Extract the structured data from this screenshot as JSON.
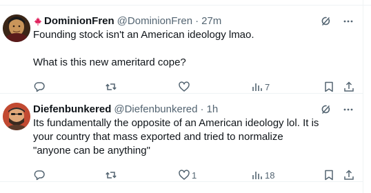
{
  "posts": [
    {
      "display_name": "DominionFren",
      "handle": "@DominionFren",
      "separator": "·",
      "time": "27m",
      "flag_icon": "canada-maple-leaf-icon",
      "text": "Founding stock isn't an American ideology lmao.\n\nWhat is this new ameritard cope?",
      "replies": "",
      "reposts": "",
      "likes": "",
      "views": "7"
    },
    {
      "display_name": "Diefenbunkered",
      "handle": "@Diefenbunkered",
      "separator": "·",
      "time": "1h",
      "text": "Its fundamentally the opposite of an American ideology lol. It is your country that mass exported and tried to normalize \"anyone can be anything\"",
      "replies": "",
      "reposts": "",
      "likes": "1",
      "views": "18"
    }
  ],
  "colors": {
    "text_primary": "#0f1419",
    "text_secondary": "#536471",
    "divider": "#eff3f4",
    "maple_leaf": "#e0245e"
  },
  "icons": [
    "grok-icon",
    "more-icon",
    "reply-icon",
    "repost-icon",
    "like-icon",
    "views-icon",
    "bookmark-icon",
    "share-icon"
  ]
}
